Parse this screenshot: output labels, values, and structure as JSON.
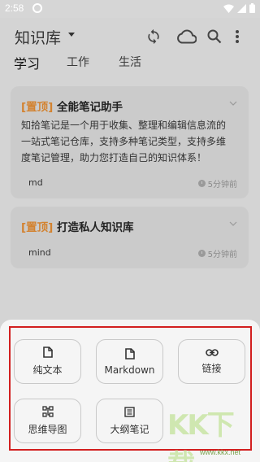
{
  "status": {
    "time": "2:58"
  },
  "appbar": {
    "title": "知识库",
    "icons": [
      "sync-icon",
      "cloud-icon",
      "search-icon",
      "more-vert-icon"
    ]
  },
  "tabs": [
    {
      "label": "学习",
      "active": true
    },
    {
      "label": "工作",
      "active": false
    },
    {
      "label": "生活",
      "active": false
    }
  ],
  "notes": [
    {
      "tag": "[置顶]",
      "title": "全能笔记助手",
      "lines": [
        "知拾笔记是一个用于收集、整理和编辑信息流的",
        "一站式笔记仓库，支持多种笔记类型，支持多维",
        "度笔记管理，助力您打造自己的知识体系！"
      ],
      "label": "md",
      "time": "5分钟前"
    },
    {
      "tag": "[置顶]",
      "title": "打造私人知识库",
      "lines": [],
      "label": "mind",
      "time": "5分钟前"
    }
  ],
  "sheet": {
    "options": [
      {
        "label": "纯文本",
        "icon": "document-icon"
      },
      {
        "label": "Markdown",
        "icon": "document-icon"
      },
      {
        "label": "链接",
        "icon": "link-icon"
      },
      {
        "label": "思维导图",
        "icon": "mindmap-icon"
      },
      {
        "label": "大纲笔记",
        "icon": "outline-icon"
      }
    ]
  },
  "watermark": {
    "text": "KK下载",
    "url": "www.kkx.net"
  }
}
